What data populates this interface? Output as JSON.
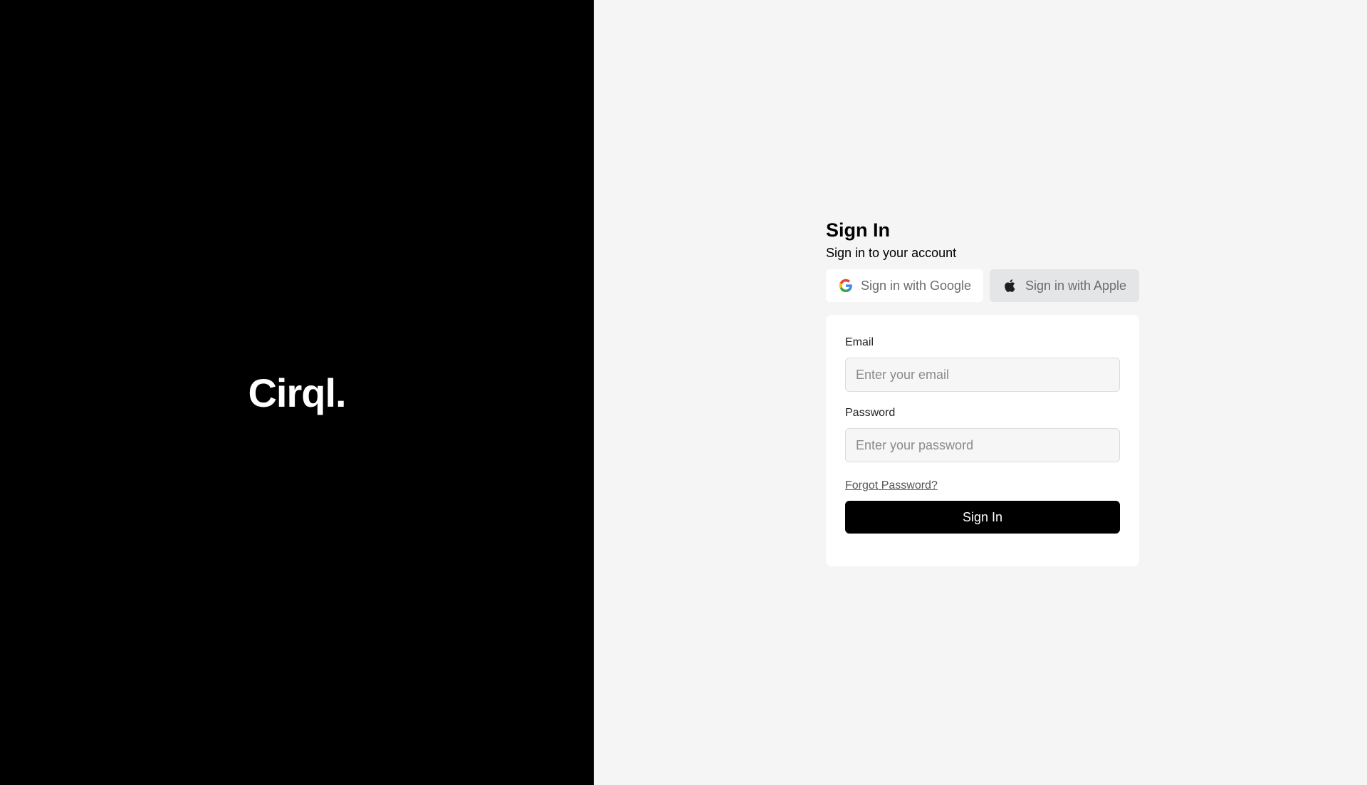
{
  "brand": {
    "logo_text": "Cirql."
  },
  "signin": {
    "title": "Sign In",
    "subtitle": "Sign in to your account",
    "google_label": "Sign in with Google",
    "apple_label": "Sign in with Apple",
    "email_label": "Email",
    "email_placeholder": "Enter your email",
    "password_label": "Password",
    "password_placeholder": "Enter your password",
    "forgot_label": "Forgot Password?",
    "submit_label": "Sign In"
  },
  "icons": {
    "google": "google-icon",
    "apple": "apple-icon"
  },
  "colors": {
    "brand_bg": "#000000",
    "page_bg": "#f5f5f5",
    "primary_button": "#000000",
    "apple_button_bg": "#e4e5e7"
  }
}
